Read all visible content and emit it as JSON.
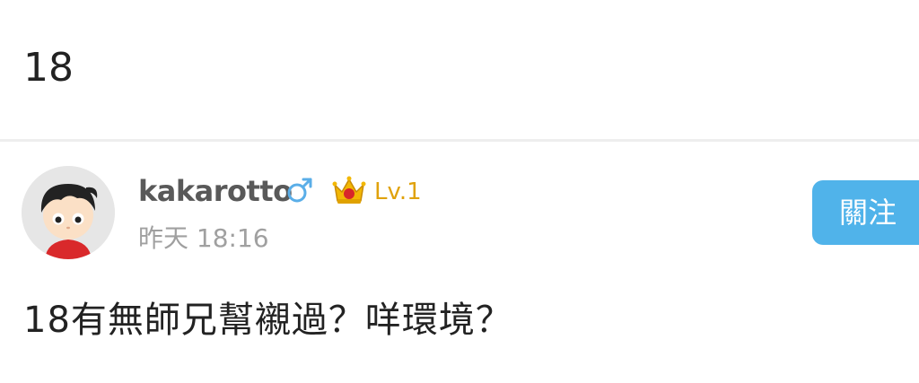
{
  "thread": {
    "title": "18"
  },
  "post": {
    "author": {
      "username": "kakarotto",
      "gender_icon": "male-symbol-icon",
      "gender_color": "#5aaee8",
      "rank_icon": "crown-icon",
      "level": "Lv.1",
      "level_color": "#e0a20c"
    },
    "timestamp": "昨天 18:16",
    "follow_label": "關注",
    "follow_color": "#50b3ea",
    "body": "18有無師兄幫襯過？咩環境？"
  }
}
